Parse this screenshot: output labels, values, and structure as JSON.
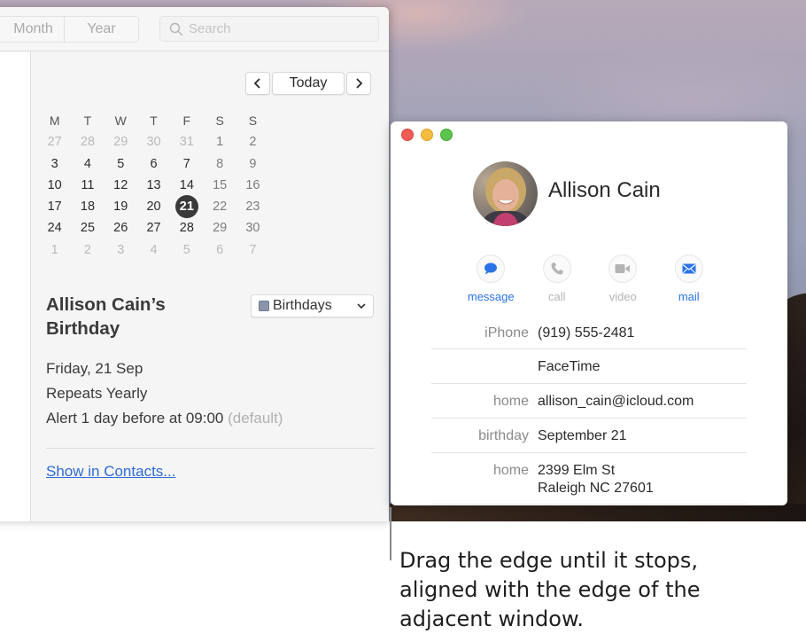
{
  "calendar_window": {
    "toolbar": {
      "view_buttons": [
        "Month",
        "Year"
      ],
      "search_placeholder": "Search"
    },
    "navigation": {
      "prev_label": "‹",
      "today_label": "Today",
      "next_label": "›"
    },
    "mini_calendar": {
      "weekday_headers": [
        "M",
        "T",
        "W",
        "T",
        "F",
        "S",
        "S"
      ],
      "weeks": [
        [
          {
            "d": "27",
            "t": "other"
          },
          {
            "d": "28",
            "t": "other"
          },
          {
            "d": "29",
            "t": "other"
          },
          {
            "d": "30",
            "t": "other"
          },
          {
            "d": "31",
            "t": "other"
          },
          {
            "d": "1",
            "t": "weekend"
          },
          {
            "d": "2",
            "t": "weekend"
          }
        ],
        [
          {
            "d": "3",
            "t": ""
          },
          {
            "d": "4",
            "t": ""
          },
          {
            "d": "5",
            "t": ""
          },
          {
            "d": "6",
            "t": ""
          },
          {
            "d": "7",
            "t": ""
          },
          {
            "d": "8",
            "t": "weekend"
          },
          {
            "d": "9",
            "t": "weekend"
          }
        ],
        [
          {
            "d": "10",
            "t": ""
          },
          {
            "d": "11",
            "t": ""
          },
          {
            "d": "12",
            "t": ""
          },
          {
            "d": "13",
            "t": ""
          },
          {
            "d": "14",
            "t": ""
          },
          {
            "d": "15",
            "t": "weekend"
          },
          {
            "d": "16",
            "t": "weekend"
          }
        ],
        [
          {
            "d": "17",
            "t": ""
          },
          {
            "d": "18",
            "t": ""
          },
          {
            "d": "19",
            "t": ""
          },
          {
            "d": "20",
            "t": ""
          },
          {
            "d": "21",
            "t": "selected"
          },
          {
            "d": "22",
            "t": "weekend"
          },
          {
            "d": "23",
            "t": "weekend"
          }
        ],
        [
          {
            "d": "24",
            "t": ""
          },
          {
            "d": "25",
            "t": ""
          },
          {
            "d": "26",
            "t": ""
          },
          {
            "d": "27",
            "t": ""
          },
          {
            "d": "28",
            "t": ""
          },
          {
            "d": "29",
            "t": "weekend"
          },
          {
            "d": "30",
            "t": "weekend"
          }
        ],
        [
          {
            "d": "1",
            "t": "other"
          },
          {
            "d": "2",
            "t": "other"
          },
          {
            "d": "3",
            "t": "other"
          },
          {
            "d": "4",
            "t": "other"
          },
          {
            "d": "5",
            "t": "other"
          },
          {
            "d": "6",
            "t": "other"
          },
          {
            "d": "7",
            "t": "other"
          }
        ]
      ],
      "selected_day": "21"
    },
    "event": {
      "title": "Allison Cain’s Birthday",
      "calendar_name": "Birthdays",
      "calendar_color": "#8b96ac",
      "date": "Friday, 21 Sep",
      "repeat": "Repeats Yearly",
      "alert": "Alert 1 day before at 09:00",
      "alert_suffix": "(default)",
      "link": "Show in Contacts..."
    }
  },
  "contact_card": {
    "name": "Allison Cain",
    "actions": [
      {
        "label": "message",
        "icon": "message-bubble-icon",
        "enabled": true
      },
      {
        "label": "call",
        "icon": "phone-icon",
        "enabled": false
      },
      {
        "label": "video",
        "icon": "video-camera-icon",
        "enabled": false
      },
      {
        "label": "mail",
        "icon": "envelope-icon",
        "enabled": true
      }
    ],
    "fields": [
      {
        "label": "iPhone",
        "value": "(919) 555-2481"
      },
      {
        "label": "",
        "value": "FaceTime"
      },
      {
        "label": "home",
        "value": "allison_cain@icloud.com"
      },
      {
        "label": "birthday",
        "value": "September 21"
      },
      {
        "label": "home",
        "value": "2399 Elm St",
        "value2": "Raleigh NC 27601"
      }
    ]
  },
  "callout": {
    "text": "Drag the edge until it stops, aligned with the edge of the adjacent window."
  },
  "colors": {
    "link_blue": "#2e6bd6",
    "action_blue": "#2a72e6",
    "selected_day": "#3a3a3a"
  }
}
